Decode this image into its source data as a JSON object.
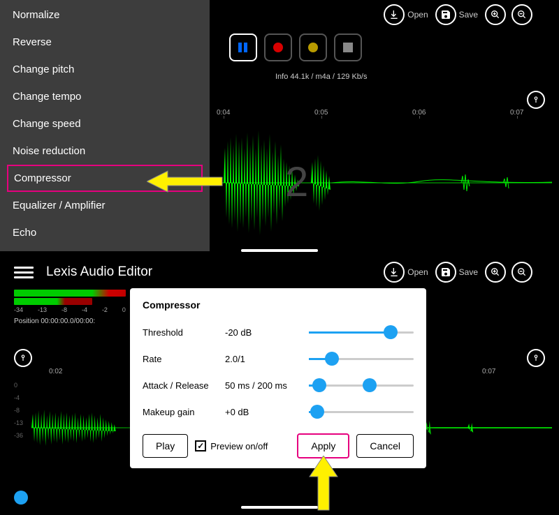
{
  "top": {
    "menu": [
      "Normalize",
      "Reverse",
      "Change pitch",
      "Change tempo",
      "Change speed",
      "Noise reduction",
      "Compressor",
      "Equalizer / Amplifier",
      "Echo"
    ],
    "highlight_index": 6,
    "toolbar": {
      "open": "Open",
      "save": "Save"
    },
    "info": "Info  44.1k / m4a / 129 Kb/s",
    "time_marks": [
      "0:04",
      "0:05",
      "0:06",
      "0:07"
    ],
    "bg_number": "2"
  },
  "bottom": {
    "title": "Lexis Audio Editor",
    "toolbar": {
      "open": "Open",
      "save": "Save"
    },
    "meter_scale": [
      "-34",
      "-13",
      "-8",
      "-4",
      "-2",
      "0"
    ],
    "position_label": "Position  00:00:00.0/00:00:",
    "time_marks": [
      "0:02",
      "0:07"
    ],
    "db_scale": [
      "0",
      "-4",
      "-8",
      "-13",
      "-36"
    ]
  },
  "dialog": {
    "title": "Compressor",
    "rows": {
      "threshold": {
        "label": "Threshold",
        "value": "-20 dB",
        "fill": 78
      },
      "rate": {
        "label": "Rate",
        "value": "2.0/1",
        "fill": 22
      },
      "attack": {
        "label": "Attack / Release",
        "value": "50 ms  /  200 ms",
        "fillA": 10,
        "fillB": 58
      },
      "makeup": {
        "label": "Makeup gain",
        "value": "+0 dB",
        "fill": 8
      }
    },
    "buttons": {
      "play": "Play",
      "preview": "Preview on/off",
      "apply": "Apply",
      "cancel": "Cancel"
    }
  }
}
